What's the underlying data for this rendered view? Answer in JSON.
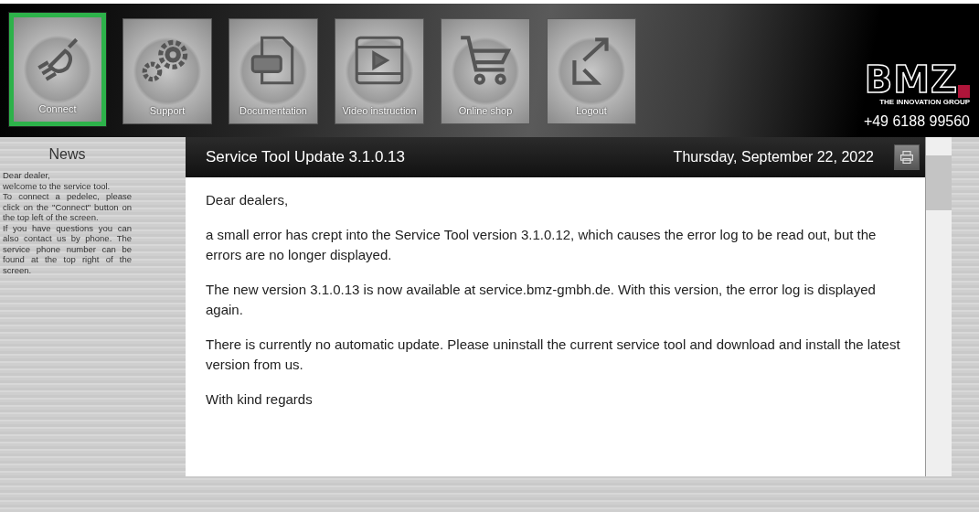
{
  "nav": [
    {
      "label": "Connect",
      "kind": "plug",
      "selected": true
    },
    {
      "label": "Support",
      "kind": "gears",
      "selected": false
    },
    {
      "label": "Documentation",
      "kind": "pdf",
      "selected": false
    },
    {
      "label": "Video instruction",
      "kind": "video",
      "selected": false
    },
    {
      "label": "Online shop",
      "kind": "cart",
      "selected": false
    },
    {
      "label": "Logout",
      "kind": "logout",
      "selected": false
    }
  ],
  "logo": {
    "letters": "BMZ",
    "tagline": "THE INNOVATION GROUP"
  },
  "phone": "+49 6188 99560",
  "news": {
    "title": "News",
    "paragraphs": [
      "Dear dealer,",
      "welcome to the service tool.",
      "To connect a pedelec, please click on the \"Connect\" button on the top left of the screen.",
      "If you have questions you can also contact us by phone. The service phone number can be found at the top right of the screen."
    ]
  },
  "article": {
    "title": "Service Tool Update 3.1.0.13",
    "date": "Thursday, September 22, 2022",
    "paragraphs": [
      "Dear dealers,",
      "a small error has crept into the Service Tool version 3.1.0.12, which causes the error log to be read out, but the errors are no longer displayed.",
      "The new version 3.1.0.13 is now available at service.bmz-gmbh.de. With this version, the error log is displayed again.",
      "There is currently no automatic update. Please uninstall the current service tool and download and install the latest version from us.",
      "With kind regards"
    ]
  }
}
